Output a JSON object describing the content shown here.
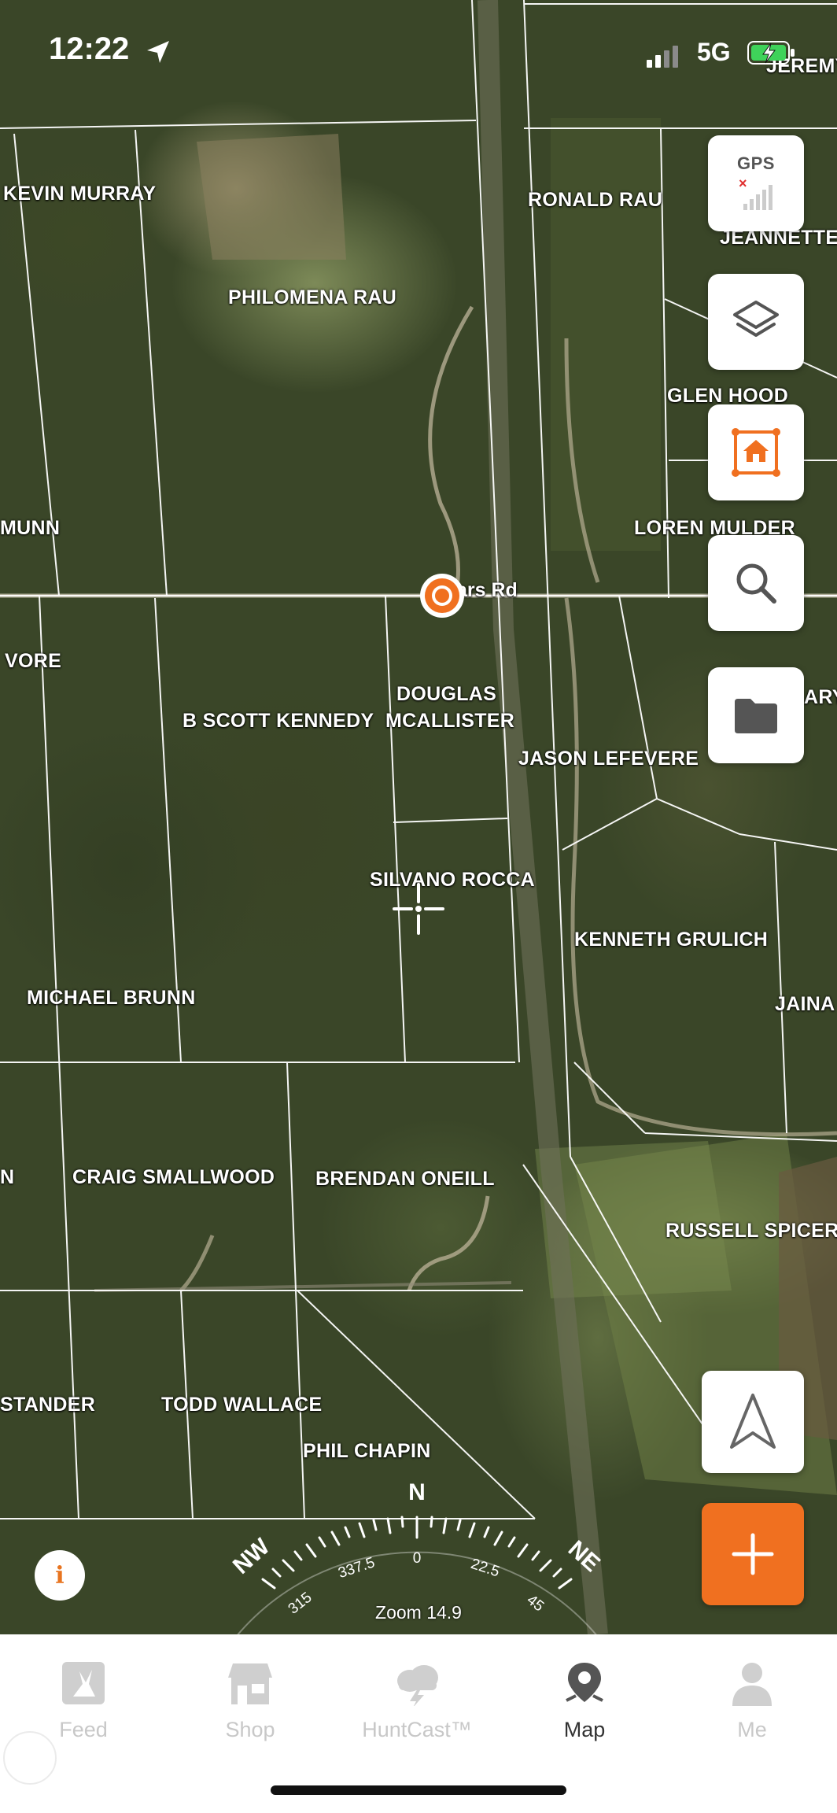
{
  "status_bar": {
    "time": "12:22",
    "network": "5G"
  },
  "map": {
    "road_label": "ars Rd",
    "owners": [
      "JEREMY",
      "KEVIN MURRAY",
      "RONALD RAU",
      "JEANNETTE",
      "PHILOMENA RAU",
      "GLEN HOOD",
      "MUNN",
      "LOREN MULDER",
      "VORE",
      "DOUGLAS",
      "MCALLISTER",
      "B SCOTT KENNEDY",
      "ARY",
      "JASON LEFEVERE",
      "SILVANO ROCCA",
      "KENNETH GRULICH",
      "MICHAEL BRUNN",
      "JAINA",
      "N",
      "CRAIG SMALLWOOD",
      "BRENDAN ONEILL",
      "RUSSELL SPICER",
      "STANDER",
      "TODD WALLACE",
      "PHIL CHAPIN"
    ]
  },
  "controls": {
    "gps_label": "GPS",
    "side_buttons": [
      "layers-icon",
      "home-area-icon",
      "search-icon",
      "folder-icon"
    ]
  },
  "compass": {
    "north": "N",
    "nw": "NW",
    "ne": "NE",
    "ticks": [
      "315",
      "337.5",
      "0",
      "22.5",
      "45"
    ]
  },
  "zoom_label": "Zoom 14.9",
  "info_label": "i",
  "tabs": [
    {
      "label": "Feed",
      "icon": "feed-icon",
      "active": false
    },
    {
      "label": "Shop",
      "icon": "shop-icon",
      "active": false
    },
    {
      "label": "HuntCast™",
      "icon": "weather-icon",
      "active": false
    },
    {
      "label": "Map",
      "icon": "map-pin-icon",
      "active": true
    },
    {
      "label": "Me",
      "icon": "person-icon",
      "active": false
    }
  ],
  "colors": {
    "accent": "#f07020",
    "parcel_line": "#ffffff"
  }
}
